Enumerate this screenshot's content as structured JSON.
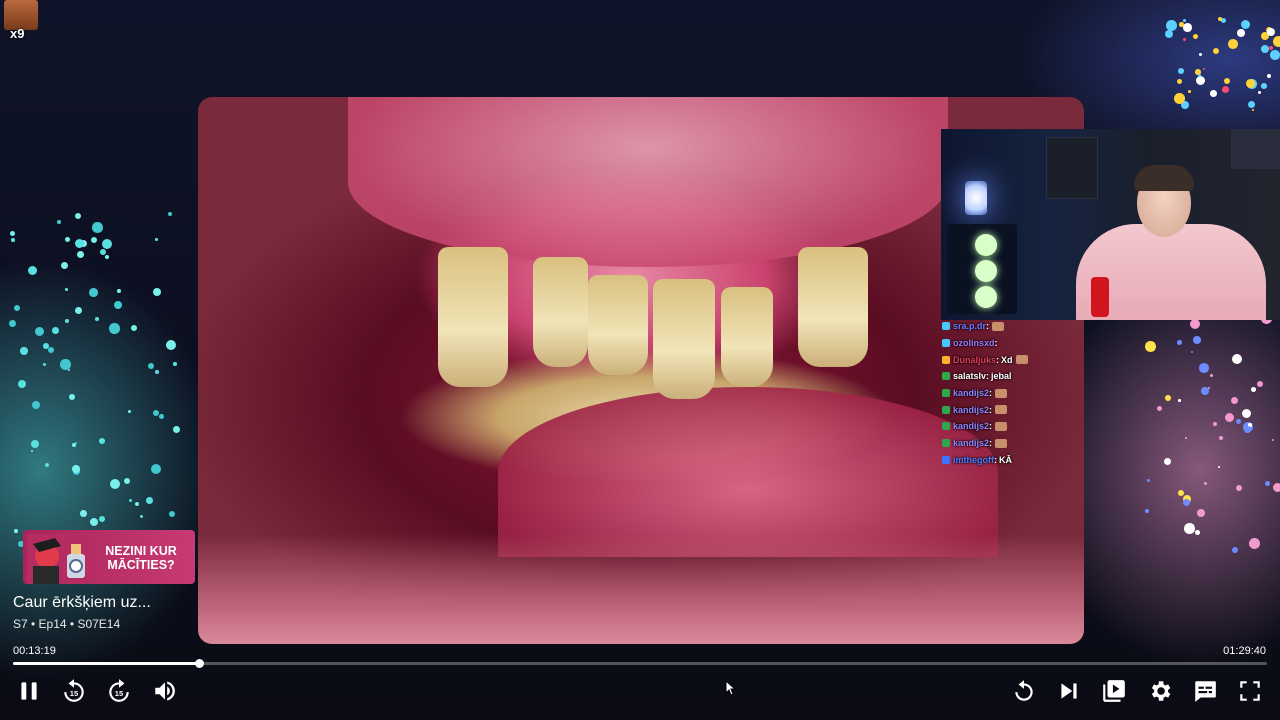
{
  "overlay": {
    "viewer_count": "x9"
  },
  "chat": [
    {
      "user": "sra.p.dr",
      "color": "#6c7cff",
      "badge_color": "#45c7ff",
      "message": "",
      "emote": true
    },
    {
      "user": "ozolinsxd",
      "color": "#9b7cff",
      "badge_color": "#45c7ff",
      "message": "",
      "emote": false
    },
    {
      "user": "Dunaljuks",
      "color": "#e43d58",
      "badge_color": "#ffb02e",
      "message": "Xd",
      "emote": true
    },
    {
      "user": "salatslv",
      "color": "#ffffff",
      "badge_color": "#2ea84a",
      "message": "jebal",
      "emote": false
    },
    {
      "user": "kandijs2",
      "color": "#8f86ff",
      "badge_color": "#2ea84a",
      "message": "",
      "emote": true
    },
    {
      "user": "kandijs2",
      "color": "#8f86ff",
      "badge_color": "#2ea84a",
      "message": "",
      "emote": true
    },
    {
      "user": "kandijs2",
      "color": "#8f86ff",
      "badge_color": "#2ea84a",
      "message": "",
      "emote": true
    },
    {
      "user": "kandijs2",
      "color": "#8f86ff",
      "badge_color": "#2ea84a",
      "message": "",
      "emote": true
    },
    {
      "user": "imthegoff",
      "color": "#4e7bff",
      "badge_color": "#3b72ff",
      "message": "KĀ",
      "emote": false
    }
  ],
  "promo": {
    "line1": "NEZINI KUR",
    "line2": "MĀCĪTIES?"
  },
  "episode": {
    "title": "Caur ērkšķiem uz...",
    "subtitle": "S7 • Ep14 • S07E14"
  },
  "playback": {
    "current_time": "00:13:19",
    "total_time": "01:29:40",
    "progress": 0.148
  },
  "controls": {
    "left": [
      "pause-icon",
      "rewind-15-icon",
      "forward-15-icon",
      "volume-icon"
    ],
    "right": [
      "restart-icon",
      "next-episode-icon",
      "episodes-icon",
      "settings-icon",
      "subtitles-icon",
      "fullscreen-icon"
    ],
    "skip_seconds": "15"
  },
  "colors": {
    "accent": "#ffffff",
    "promo": "#c83a74"
  }
}
